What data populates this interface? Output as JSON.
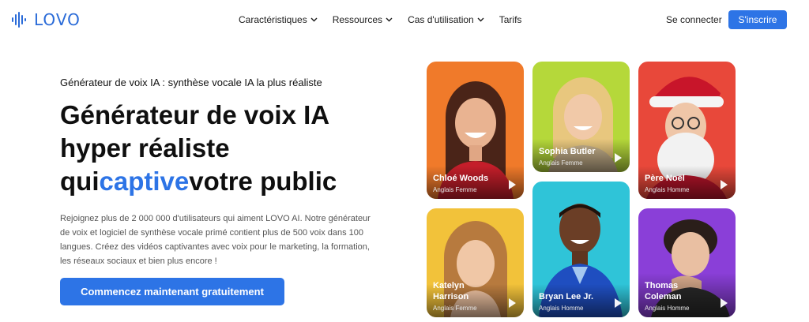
{
  "brand": {
    "name": "LOVO",
    "color": "#2a6bd8"
  },
  "nav": {
    "items": [
      {
        "label": "Caractéristiques",
        "dropdown": true
      },
      {
        "label": "Ressources",
        "dropdown": true
      },
      {
        "label": "Cas d'utilisation",
        "dropdown": true
      },
      {
        "label": "Tarifs",
        "dropdown": false
      }
    ],
    "login_label": "Se connecter",
    "signup_label": "S'inscrire"
  },
  "hero": {
    "eyebrow": "Générateur de voix IA : synthèse vocale IA la plus réaliste",
    "headline_line1": "Générateur de voix IA",
    "headline_line2": "hyper réaliste",
    "headline_line3_pre": "qui",
    "headline_line3_accent": "captive",
    "headline_line3_post": "votre public",
    "description": "Rejoignez plus de 2 000 000 d'utilisateurs qui aiment LOVO AI. Notre générateur de voix et logiciel de synthèse vocale primé contient plus de 500 voix dans 100 langues. Créez des vidéos captivantes avec voix pour le marketing, la formation, les réseaux sociaux et bien plus encore !",
    "cta_label": "Commencez maintenant gratuitement",
    "accent_color": "#2d74e6"
  },
  "voices": [
    {
      "name": "Chloé Woods",
      "meta": "Anglais Femme",
      "bg": "#f07a2a"
    },
    {
      "name": "Sophia Butler",
      "meta": "Anglais Femme",
      "bg": "#b5d83a"
    },
    {
      "name": "Père Noël",
      "meta": "Anglais Homme",
      "bg": "#e8483a"
    },
    {
      "name": "Katelyn Harrison",
      "meta": "Anglais Femme",
      "bg": "#f2c23a"
    },
    {
      "name": "Bryan Lee Jr.",
      "meta": "Anglais Homme",
      "bg": "#2fc4d8"
    },
    {
      "name": "Thomas Coleman",
      "meta": "Anglais Homme",
      "bg": "#8a3fd8"
    }
  ]
}
